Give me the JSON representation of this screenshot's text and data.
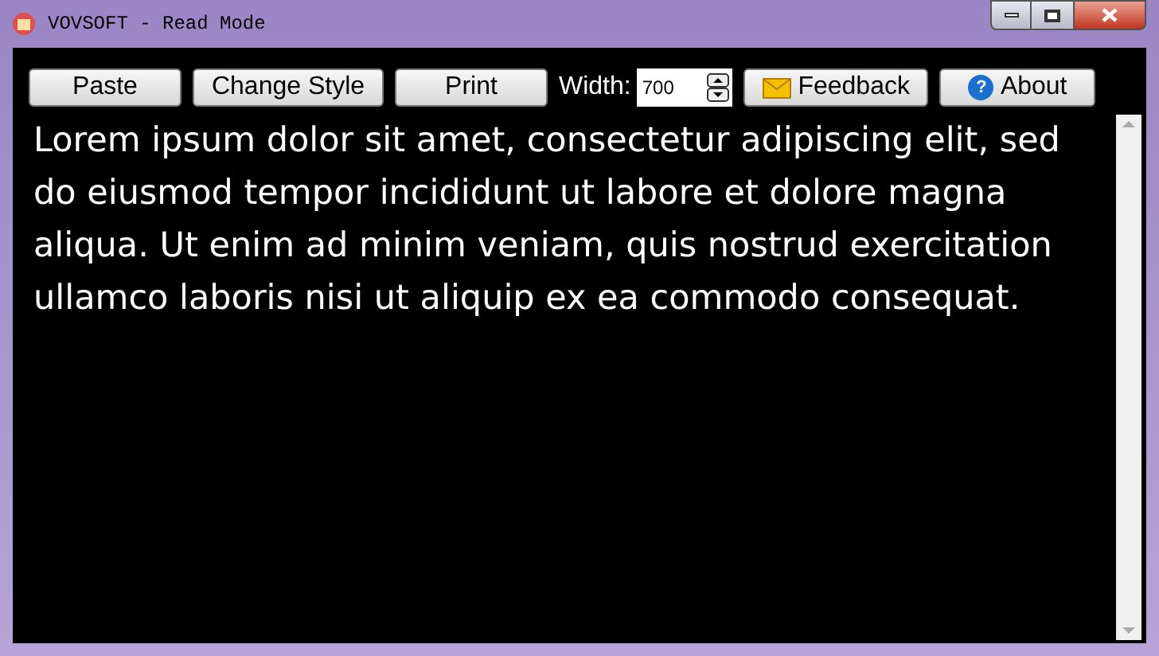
{
  "window": {
    "title": "VOVSOFT - Read Mode"
  },
  "toolbar": {
    "buttons": [
      {
        "label": "Paste"
      },
      {
        "label": "Change Style"
      },
      {
        "label": "Print"
      }
    ],
    "width_label": "Width:",
    "width_value": "700",
    "right_buttons": [
      {
        "label": "Feedback",
        "kind": "mail"
      },
      {
        "label": "About",
        "kind": "help",
        "icon": "?"
      }
    ]
  },
  "text": "Lorem ipsum dolor sit amet, consectetur adipiscing elit, sed do eiusmod tempor incididunt ut labore et dolore magna aliqua. Ut enim ad minim veniam, quis nostrud exercitation ullamco laboris nisi ut aliquip ex ea commodo consequat."
}
